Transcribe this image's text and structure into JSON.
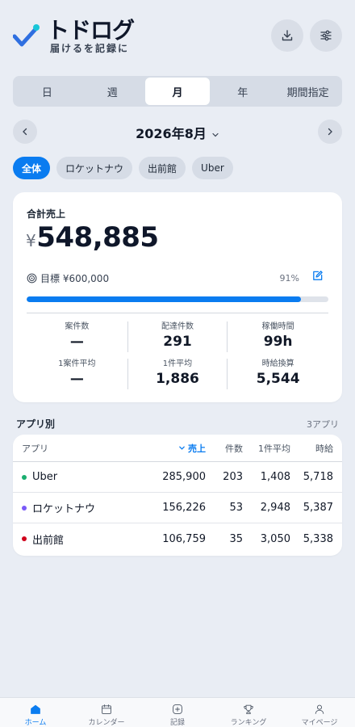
{
  "app": {
    "title": "トドログ",
    "subtitle": "届けるを記録に"
  },
  "colors": {
    "accent": "#0a7cf0",
    "uber": "#1aae6f",
    "rocketnow": "#7a5af8",
    "demaekan": "#d0021b"
  },
  "period_tabs": [
    {
      "label": "日"
    },
    {
      "label": "週"
    },
    {
      "label": "月",
      "active": true
    },
    {
      "label": "年"
    },
    {
      "label": "期間指定"
    }
  ],
  "month": {
    "label": "2026年8月"
  },
  "filters": [
    {
      "label": "全体",
      "active": true
    },
    {
      "label": "ロケットナウ"
    },
    {
      "label": "出前館"
    },
    {
      "label": "Uber"
    }
  ],
  "sales": {
    "label": "合計売上",
    "currency": "¥",
    "amount": "548,885",
    "target_label": "目標 ¥600,000",
    "progress_pct_label": "91%",
    "progress": 0.91
  },
  "stats": [
    {
      "label": "案件数",
      "value": "—"
    },
    {
      "label": "配達件数",
      "value": "291"
    },
    {
      "label": "稼働時間",
      "value": "99h"
    },
    {
      "label": "1案件平均",
      "value": "—"
    },
    {
      "label": "1件平均",
      "value": "1,886"
    },
    {
      "label": "時給換算",
      "value": "5,544"
    }
  ],
  "apps_section": {
    "title": "アプリ別",
    "count": "3アプリ"
  },
  "table": {
    "headers": {
      "app": "アプリ",
      "sales": "売上",
      "count": "件数",
      "avg": "1件平均",
      "hourly": "時給"
    },
    "rows": [
      {
        "app": "Uber",
        "sales": "285,900",
        "count": "203",
        "avg": "1,408",
        "hourly": "5,718"
      },
      {
        "app": "ロケットナウ",
        "sales": "156,226",
        "count": "53",
        "avg": "2,948",
        "hourly": "5,387"
      },
      {
        "app": "出前館",
        "sales": "106,759",
        "count": "35",
        "avg": "3,050",
        "hourly": "5,338"
      }
    ]
  },
  "nav": [
    {
      "label": "ホーム",
      "icon": "home-icon"
    },
    {
      "label": "カレンダー",
      "icon": "calendar-icon"
    },
    {
      "label": "記録",
      "icon": "plus-square-icon"
    },
    {
      "label": "ランキング",
      "icon": "trophy-icon"
    },
    {
      "label": "マイページ",
      "icon": "user-icon"
    }
  ]
}
